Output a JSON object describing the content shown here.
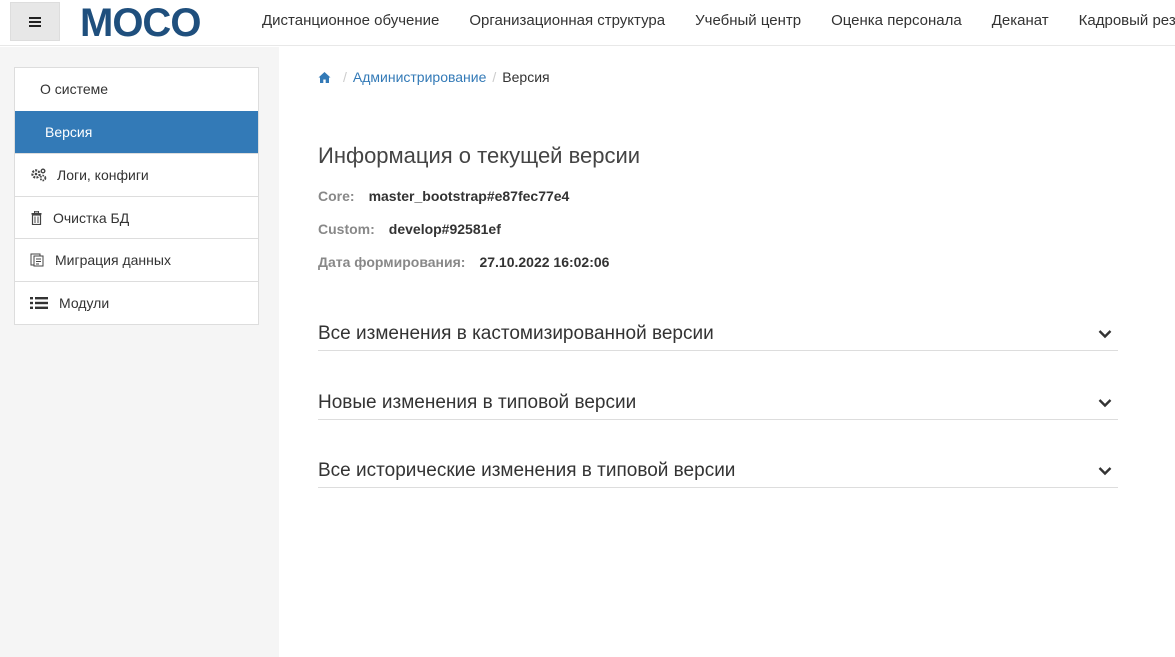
{
  "header": {
    "logo_text": "MOCO",
    "nav": [
      "Дистанционное обучение",
      "Организационная структура",
      "Учебный центр",
      "Оценка персонала",
      "Деканат",
      "Кадровый резерв"
    ]
  },
  "sidebar": {
    "items": [
      {
        "label": "О системе",
        "icon": ""
      },
      {
        "label": "Версия",
        "icon": ""
      },
      {
        "label": "Логи, конфиги",
        "icon": "gears-icon"
      },
      {
        "label": "Очистка БД",
        "icon": "trash-icon"
      },
      {
        "label": "Миграция данных",
        "icon": "migration-icon"
      },
      {
        "label": "Модули",
        "icon": "list-icon"
      }
    ]
  },
  "breadcrumb": {
    "home_icon": "home-icon",
    "items": [
      "Администрирование",
      "Версия"
    ]
  },
  "version": {
    "title": "Информация о текущей версии",
    "core_label": "Core:",
    "core_value": "master_bootstrap#e87fec77e4",
    "custom_label": "Custom:",
    "custom_value": "develop#92581ef",
    "date_label": "Дата формирования:",
    "date_value": "27.10.2022 16:02:06"
  },
  "accordion": [
    {
      "title": "Все изменения в кастомизированной версии"
    },
    {
      "title": "Новые изменения в типовой версии"
    },
    {
      "title": "Все исторические изменения в типовой версии"
    }
  ],
  "colors": {
    "accent": "#337ab7",
    "logo": "#1f4f7d"
  }
}
